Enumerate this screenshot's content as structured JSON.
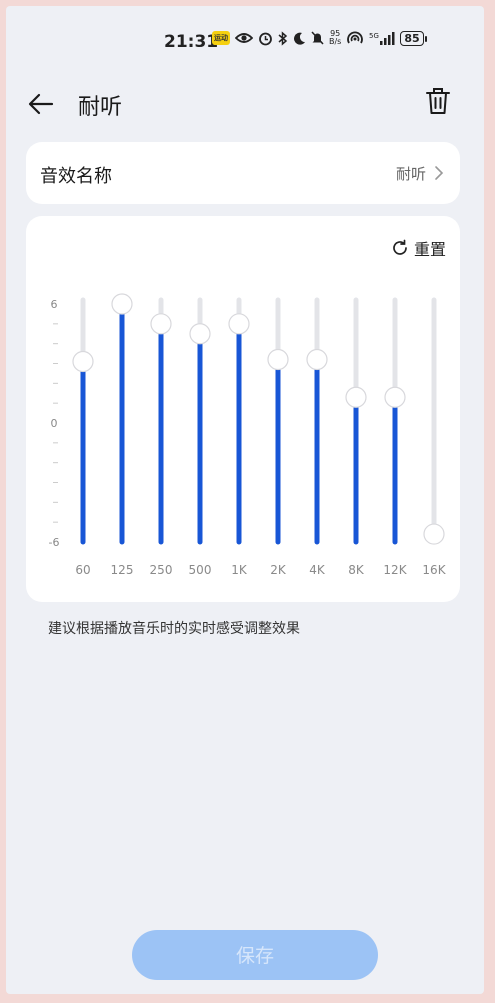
{
  "status_bar": {
    "time": "21:31",
    "badge": "运动",
    "net_speed_value": "95",
    "net_speed_unit": "B/s",
    "battery": "85"
  },
  "header": {
    "title": "耐听",
    "back_icon": "arrow-left-icon",
    "delete_icon": "trash-icon"
  },
  "name_row": {
    "label": "音效名称",
    "value": "耐听"
  },
  "equalizer": {
    "reset_label": "重置",
    "scale_top": "6",
    "scale_mid": "0",
    "scale_bottom": "-6",
    "db_min": -6,
    "db_max": 6,
    "bands": [
      {
        "label": "60",
        "gain": 3.1
      },
      {
        "label": "125",
        "gain": 6.0
      },
      {
        "label": "250",
        "gain": 5.0
      },
      {
        "label": "500",
        "gain": 4.5
      },
      {
        "label": "1K",
        "gain": 5.0
      },
      {
        "label": "2K",
        "gain": 3.2
      },
      {
        "label": "4K",
        "gain": 3.2
      },
      {
        "label": "8K",
        "gain": 1.3
      },
      {
        "label": "12K",
        "gain": 1.3
      },
      {
        "label": "16K",
        "gain": -5.6
      }
    ],
    "active_color": "#1856d6",
    "track_color": "#e3e4e8"
  },
  "hint": "建议根据播放音乐时的实时感受调整效果",
  "save_label": "保存"
}
